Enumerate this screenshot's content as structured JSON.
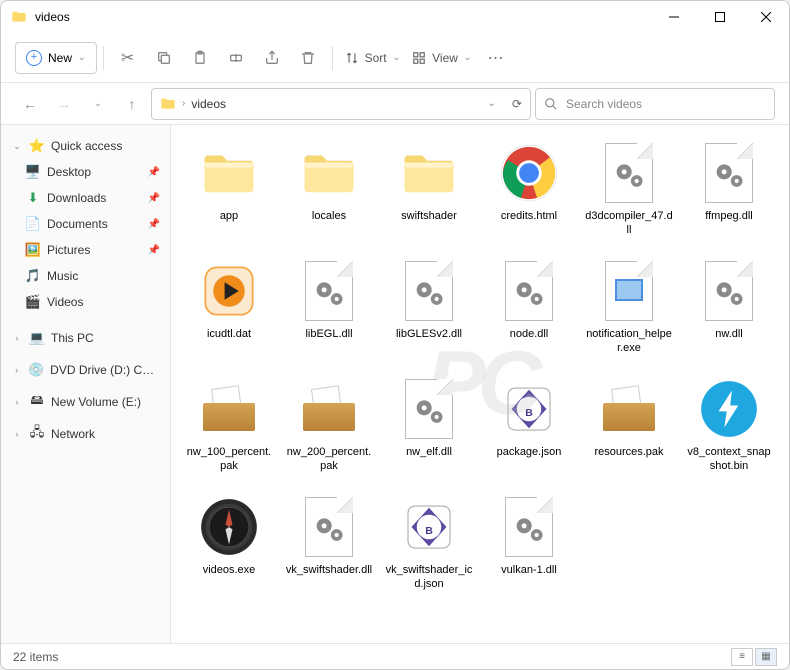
{
  "window": {
    "title": "videos"
  },
  "toolbar": {
    "new_label": "New",
    "sort_label": "Sort",
    "view_label": "View"
  },
  "breadcrumb": {
    "root_chev": "›",
    "current": "videos"
  },
  "search": {
    "placeholder": "Search videos"
  },
  "sidebar": {
    "quick_access": "Quick access",
    "items": [
      {
        "label": "Desktop"
      },
      {
        "label": "Downloads"
      },
      {
        "label": "Documents"
      },
      {
        "label": "Pictures"
      },
      {
        "label": "Music"
      },
      {
        "label": "Videos"
      }
    ],
    "this_pc": "This PC",
    "dvd": "DVD Drive (D:) CCCC",
    "volume": "New Volume (E:)",
    "network": "Network"
  },
  "files": [
    {
      "name": "app",
      "type": "folder"
    },
    {
      "name": "locales",
      "type": "folder"
    },
    {
      "name": "swiftshader",
      "type": "folder"
    },
    {
      "name": "credits.html",
      "type": "chrome"
    },
    {
      "name": "d3dcompiler_47.dll",
      "type": "dll"
    },
    {
      "name": "ffmpeg.dll",
      "type": "dll"
    },
    {
      "name": "icudtl.dat",
      "type": "media"
    },
    {
      "name": "libEGL.dll",
      "type": "dll"
    },
    {
      "name": "libGLESv2.dll",
      "type": "dll"
    },
    {
      "name": "node.dll",
      "type": "dll"
    },
    {
      "name": "notification_helper.exe",
      "type": "exe"
    },
    {
      "name": "nw.dll",
      "type": "dll"
    },
    {
      "name": "nw_100_percent.pak",
      "type": "pak"
    },
    {
      "name": "nw_200_percent.pak",
      "type": "pak"
    },
    {
      "name": "nw_elf.dll",
      "type": "dll"
    },
    {
      "name": "package.json",
      "type": "json"
    },
    {
      "name": "resources.pak",
      "type": "pak"
    },
    {
      "name": "v8_context_snapshot.bin",
      "type": "bolt"
    },
    {
      "name": "videos.exe",
      "type": "compass"
    },
    {
      "name": "vk_swiftshader.dll",
      "type": "dll"
    },
    {
      "name": "vk_swiftshader_icd.json",
      "type": "json"
    },
    {
      "name": "vulkan-1.dll",
      "type": "dll"
    }
  ],
  "status": {
    "count": "22 items"
  }
}
